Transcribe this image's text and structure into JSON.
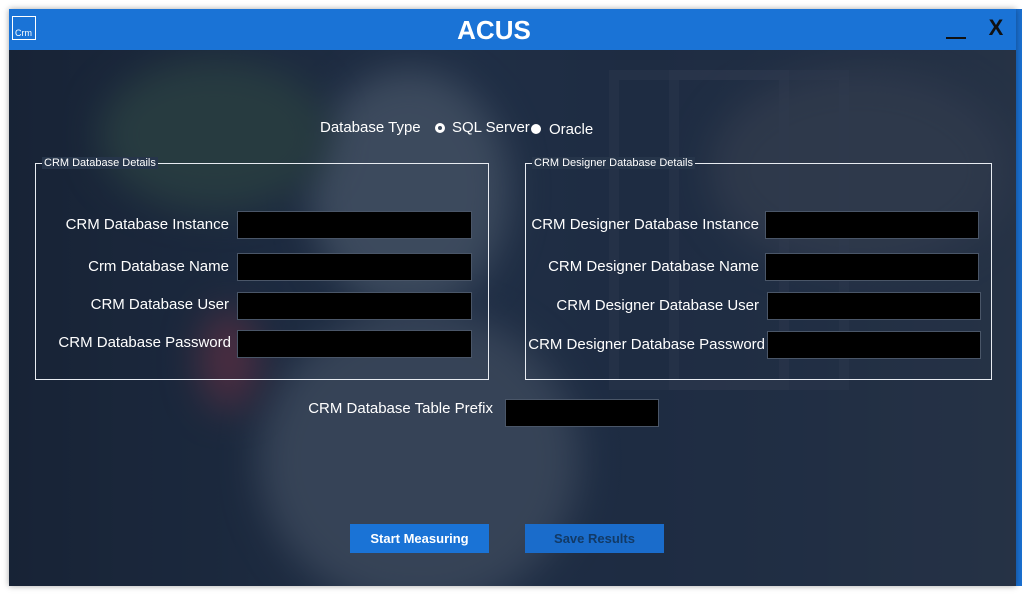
{
  "window": {
    "logo_text": "Crm",
    "title": "ACUS",
    "minimize_label": "__",
    "close_label": "X"
  },
  "database_type": {
    "label": "Database Type",
    "options": [
      {
        "label": "SQL Server",
        "selected": true
      },
      {
        "label": "Oracle",
        "selected": false
      }
    ]
  },
  "crm_group": {
    "legend": "CRM Database Details",
    "fields": [
      {
        "label": "CRM Database Instance",
        "value": ""
      },
      {
        "label": "Crm Database Name",
        "value": ""
      },
      {
        "label": "CRM Database User",
        "value": ""
      },
      {
        "label": "CRM Database Password",
        "value": ""
      }
    ]
  },
  "designer_group": {
    "legend": "CRM Designer Database Details",
    "fields": [
      {
        "label": "CRM Designer Database Instance",
        "value": ""
      },
      {
        "label": "CRM Designer Database Name",
        "value": ""
      },
      {
        "label": "CRM Designer Database User",
        "value": ""
      },
      {
        "label": "CRM Designer Database Password",
        "value": ""
      }
    ]
  },
  "prefix": {
    "label": "CRM Database Table Prefix",
    "value": ""
  },
  "actions": {
    "start_label": "Start Measuring",
    "save_label": "Save Results"
  },
  "colors": {
    "titlebar": "#1a73d6",
    "background_tint": "#1c2a3d",
    "field_bg": "#000000"
  }
}
